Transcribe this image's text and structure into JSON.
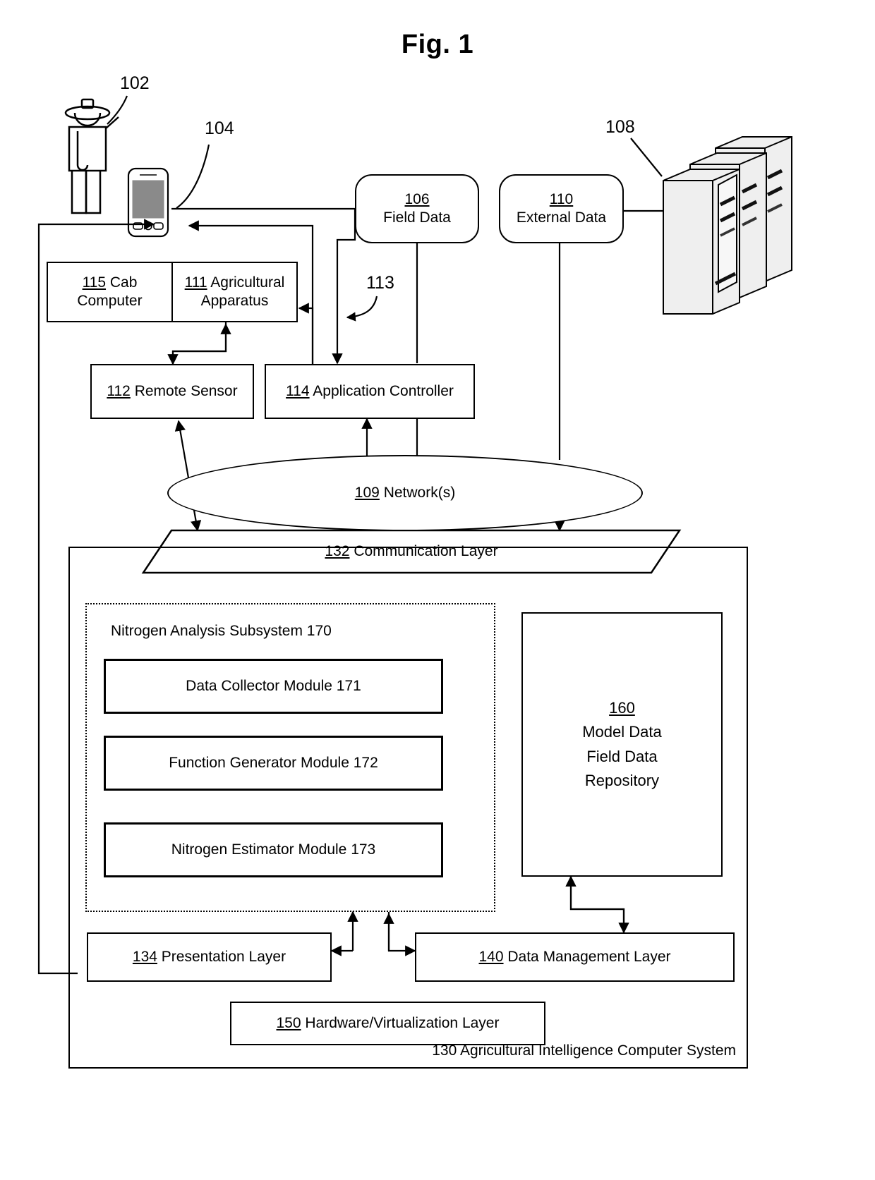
{
  "figure": {
    "title": "Fig. 1"
  },
  "refs": {
    "grower": "102",
    "device": "104",
    "servers": "108",
    "link113": "113"
  },
  "nodes": {
    "field_data": {
      "num": "106",
      "label": "Field Data"
    },
    "external_data": {
      "num": "110",
      "label": "External Data"
    },
    "cab_computer": {
      "num": "115",
      "label": "Cab Computer"
    },
    "agricultural_apparatus": {
      "num": "111",
      "label": "Agricultural Apparatus"
    },
    "remote_sensor": {
      "num": "112",
      "label": "Remote Sensor"
    },
    "application_controller": {
      "num": "114",
      "label": "Application Controller"
    },
    "network": {
      "num": "109",
      "label": "Network(s)"
    },
    "communication_layer": {
      "num": "132",
      "label": "Communication Layer"
    },
    "nitrogen_subsystem": {
      "label": "Nitrogen Analysis Subsystem 170"
    },
    "data_collector_module": {
      "label": "Data Collector Module 171"
    },
    "function_generator_module": {
      "label": "Function Generator Module 172"
    },
    "nitrogen_estimator_module": {
      "label": "Nitrogen Estimator Module 173"
    },
    "repository": {
      "num": "160",
      "line1": "Model Data",
      "line2": "Field Data",
      "line3": "Repository"
    },
    "presentation_layer": {
      "num": "134",
      "label": "Presentation Layer"
    },
    "data_management_layer": {
      "num": "140",
      "label": "Data Management Layer"
    },
    "hardware_layer": {
      "num": "150",
      "label": "Hardware/Virtualization Layer"
    },
    "system": {
      "num": "130",
      "label": "Agricultural Intelligence Computer System"
    }
  },
  "colors": {
    "stroke": "#000000",
    "background": "#ffffff",
    "screen_fill": "#8a8a8a"
  }
}
